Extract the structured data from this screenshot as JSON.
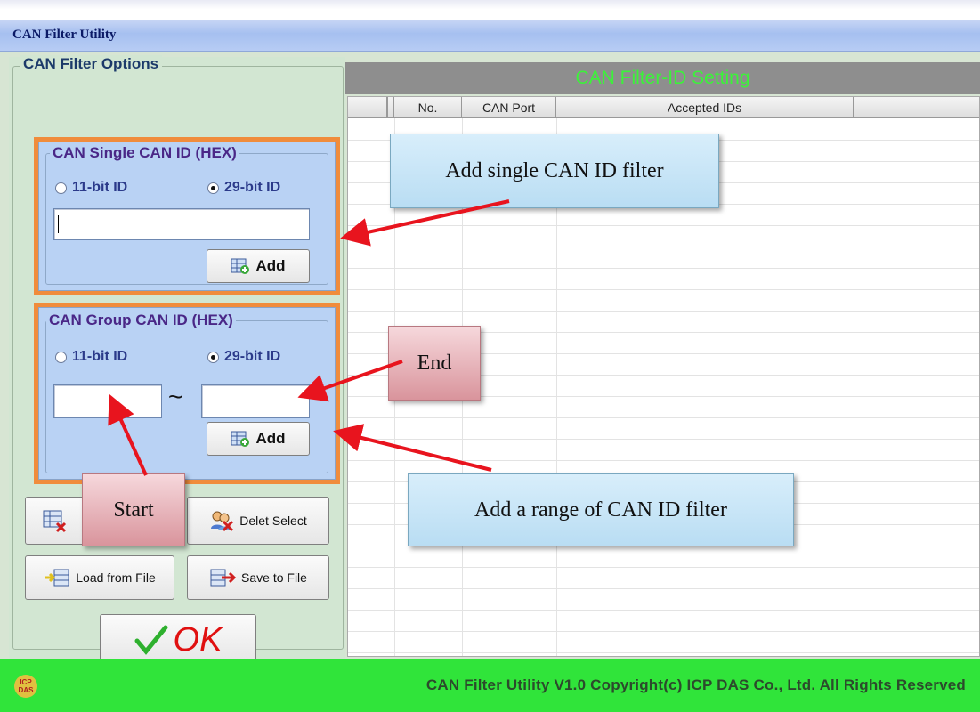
{
  "window": {
    "title": "CAN Filter Utility"
  },
  "options": {
    "legend": "CAN Filter Options",
    "single": {
      "legend": "CAN Single CAN ID (HEX)",
      "radio11": "11-bit ID",
      "radio29": "29-bit ID",
      "selected": "29-bit ID",
      "value": "",
      "add_label": "Add"
    },
    "group": {
      "legend": "CAN Group CAN ID (HEX)",
      "radio11": "11-bit ID",
      "radio29": "29-bit ID",
      "selected": "29-bit ID",
      "start": "",
      "end": "",
      "separator": "~",
      "add_label": "Add"
    },
    "delete_select_label": "Delet Select",
    "load_label": "Load from File",
    "save_label": "Save to File",
    "ok_label": "OK"
  },
  "table": {
    "header": "CAN Filter-ID Setting",
    "columns": [
      "No.",
      "CAN Port",
      "Accepted IDs"
    ]
  },
  "callouts": {
    "single": "Add single CAN ID filter",
    "end": "End",
    "start": "Start",
    "range": "Add a range of CAN ID filter"
  },
  "status": {
    "text": "CAN Filter Utility  V1.0    Copyright(c) ICP DAS Co., Ltd. All Rights Reserved",
    "logo": "ICP DAS"
  },
  "colors": {
    "accent_orange": "#f08c3c",
    "arrow": "#e8141e",
    "status_green": "#30e43a",
    "header_text": "#3cf23a"
  }
}
